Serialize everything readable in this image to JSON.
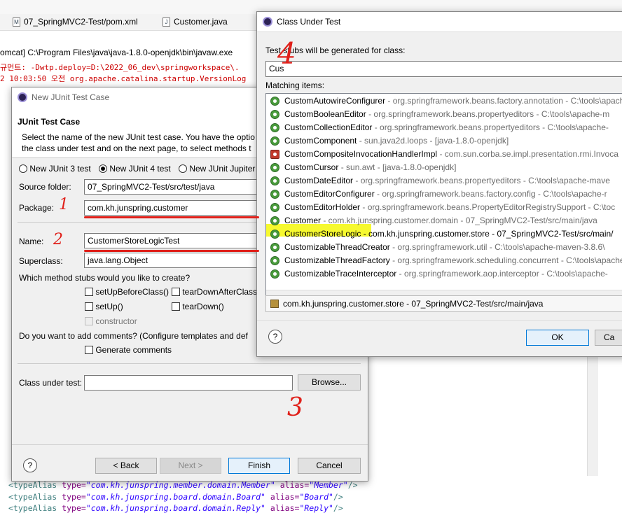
{
  "background": {
    "tabs": [
      {
        "label": "07_SpringMVC2-Test/pom.xml",
        "icon": "xml-file-icon"
      },
      {
        "label": "Customer.java",
        "icon": "java-file-icon"
      }
    ],
    "console_path": "omcat] C:\\Program Files\\java\\java-1.8.0-openjdk\\bin\\javaw.exe",
    "console_lines": [
      "규먼트:  -Dwtp.deploy=D:\\2022_06_dev\\springworkspace\\.",
      "2 10:03:50 오전 org.apache.catalina.startup.VersionLog"
    ],
    "xml_lines": [
      {
        "tag": "<typeAlias",
        "attr1": " type=",
        "val1": "\"com.kh.junspring.member.domain.Member\"",
        "attr2": " alias=",
        "val2": "\"Member\"",
        "end": "/>"
      },
      {
        "tag": "<typeAlias",
        "attr1": " type=",
        "val1": "\"com.kh.junspring.board.domain.Board\"",
        "attr2": " alias=",
        "val2": "\"Board\"",
        "end": "/>"
      },
      {
        "tag": "<typeAlias",
        "attr1": " type=",
        "val1": "\"com.kh.junspring.board.domain.Reply\"",
        "attr2": " alias=",
        "val2": "\"Reply\"",
        "end": "/>"
      }
    ]
  },
  "junit_dialog": {
    "title": "New JUnit Test Case",
    "heading": "JUnit Test Case",
    "description_1": "Select the name of the new JUnit test case. You have the optio",
    "description_2": "the class under test and on the next page, to select methods t",
    "radios": [
      {
        "label": "New JUnit 3 test",
        "selected": false
      },
      {
        "label": "New JUnit 4 test",
        "selected": true
      },
      {
        "label": "New JUnit Jupiter",
        "selected": false
      }
    ],
    "source_folder_label": "Source folder:",
    "source_folder_value": "07_SpringMVC2-Test/src/test/java",
    "package_label": "Package:",
    "package_value": "com.kh.junspring.customer",
    "name_label": "Name:",
    "name_value": "CustomerStoreLogicTest",
    "superclass_label": "Superclass:",
    "superclass_value": "java.lang.Object",
    "stubs_question": "Which method stubs would you like to create?",
    "stubs": {
      "setup_before_class": "setUpBeforeClass()",
      "teardown_after_class": "tearDownAfterClass",
      "setup": "setUp()",
      "teardown": "tearDown()",
      "constructor": "constructor"
    },
    "comments_question": "Do you want to add comments? (Configure templates and def",
    "generate_comments": "Generate comments",
    "class_under_test_label": "Class under test:",
    "class_under_test_value": "",
    "browse": "Browse...",
    "back": "< Back",
    "next": "Next >",
    "finish": "Finish",
    "cancel": "Cancel",
    "help": "?"
  },
  "class_dialog": {
    "title": "Class Under Test",
    "prompt": "Test stubs will be generated for class:",
    "search_value": "Cus",
    "matching_label": "Matching items:",
    "items": [
      {
        "name": "CustomAutowireConfigurer",
        "detail": " - org.springframework.beans.factory.annotation - C:\\tools\\apache-m"
      },
      {
        "name": "CustomBooleanEditor",
        "detail": " - org.springframework.beans.propertyeditors - C:\\tools\\apache-m"
      },
      {
        "name": "CustomCollectionEditor",
        "detail": " - org.springframework.beans.propertyeditors - C:\\tools\\apache-"
      },
      {
        "name": "CustomComponent",
        "detail": " - sun.java2d.loops - [java-1.8.0-openjdk]"
      },
      {
        "name": "CustomCompositeInvocationHandlerImpl",
        "detail": " - com.sun.corba.se.impl.presentation.rmi.Invoca"
      },
      {
        "name": "CustomCursor",
        "detail": " - sun.awt - [java-1.8.0-openjdk]"
      },
      {
        "name": "CustomDateEditor",
        "detail": " - org.springframework.beans.propertyeditors - C:\\tools\\apache-mave"
      },
      {
        "name": "CustomEditorConfigurer",
        "detail": " - org.springframework.beans.factory.config - C:\\tools\\apache-r"
      },
      {
        "name": "CustomEditorHolder",
        "detail": " - org.springframework.beans.PropertyEditorRegistrySupport - C:\\toc"
      },
      {
        "name": "Customer",
        "detail": " - com.kh.junspring.customer.domain - 07_SpringMVC2-Test/src/main/java"
      },
      {
        "name": "CustomerStoreLogic",
        "detail": " - com.kh.junspring.customer.store - 07_SpringMVC2-Test/src/main/"
      },
      {
        "name": "CustomizableThreadCreator",
        "detail": " - org.springframework.util - C:\\tools\\apache-maven-3.8.6\\"
      },
      {
        "name": "CustomizableThreadFactory",
        "detail": " - org.springframework.scheduling.concurrent - C:\\tools\\apache"
      },
      {
        "name": "CustomizableTraceInterceptor",
        "detail": " - org.springframework.aop.interceptor - C:\\tools\\apache-"
      }
    ],
    "status": "com.kh.junspring.customer.store - 07_SpringMVC2-Test/src/main/java",
    "ok": "OK",
    "cancel": "Ca",
    "help": "?"
  },
  "annotations": {
    "one": "1",
    "two": "2",
    "three": "3",
    "four": "4"
  }
}
